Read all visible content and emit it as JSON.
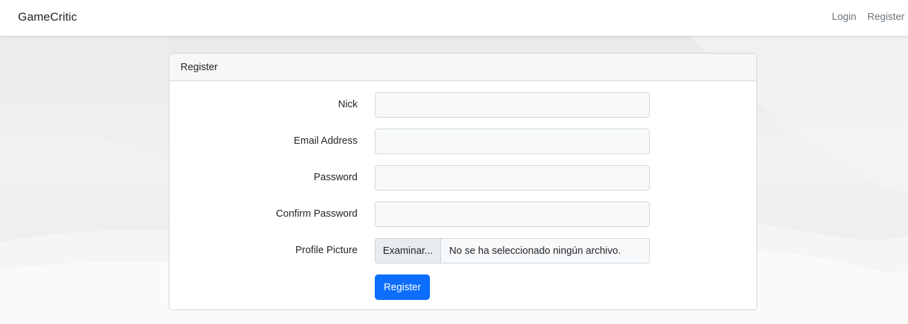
{
  "navbar": {
    "brand": "GameCritic",
    "links": [
      "Login",
      "Register"
    ]
  },
  "card": {
    "title": "Register",
    "fields": [
      {
        "label": "Nick",
        "value": "",
        "placeholder": ""
      },
      {
        "label": "Email Address",
        "value": "",
        "placeholder": ""
      },
      {
        "label": "Password",
        "value": "",
        "placeholder": ""
      },
      {
        "label": "Confirm Password",
        "value": "",
        "placeholder": ""
      }
    ],
    "file_field": {
      "label": "Profile Picture",
      "button": "Examinar...",
      "status": "No se ha seleccionado ningún archivo."
    },
    "submit_label": "Register"
  },
  "colors": {
    "primary": "#0d6efd",
    "link_muted": "#6c757d"
  }
}
